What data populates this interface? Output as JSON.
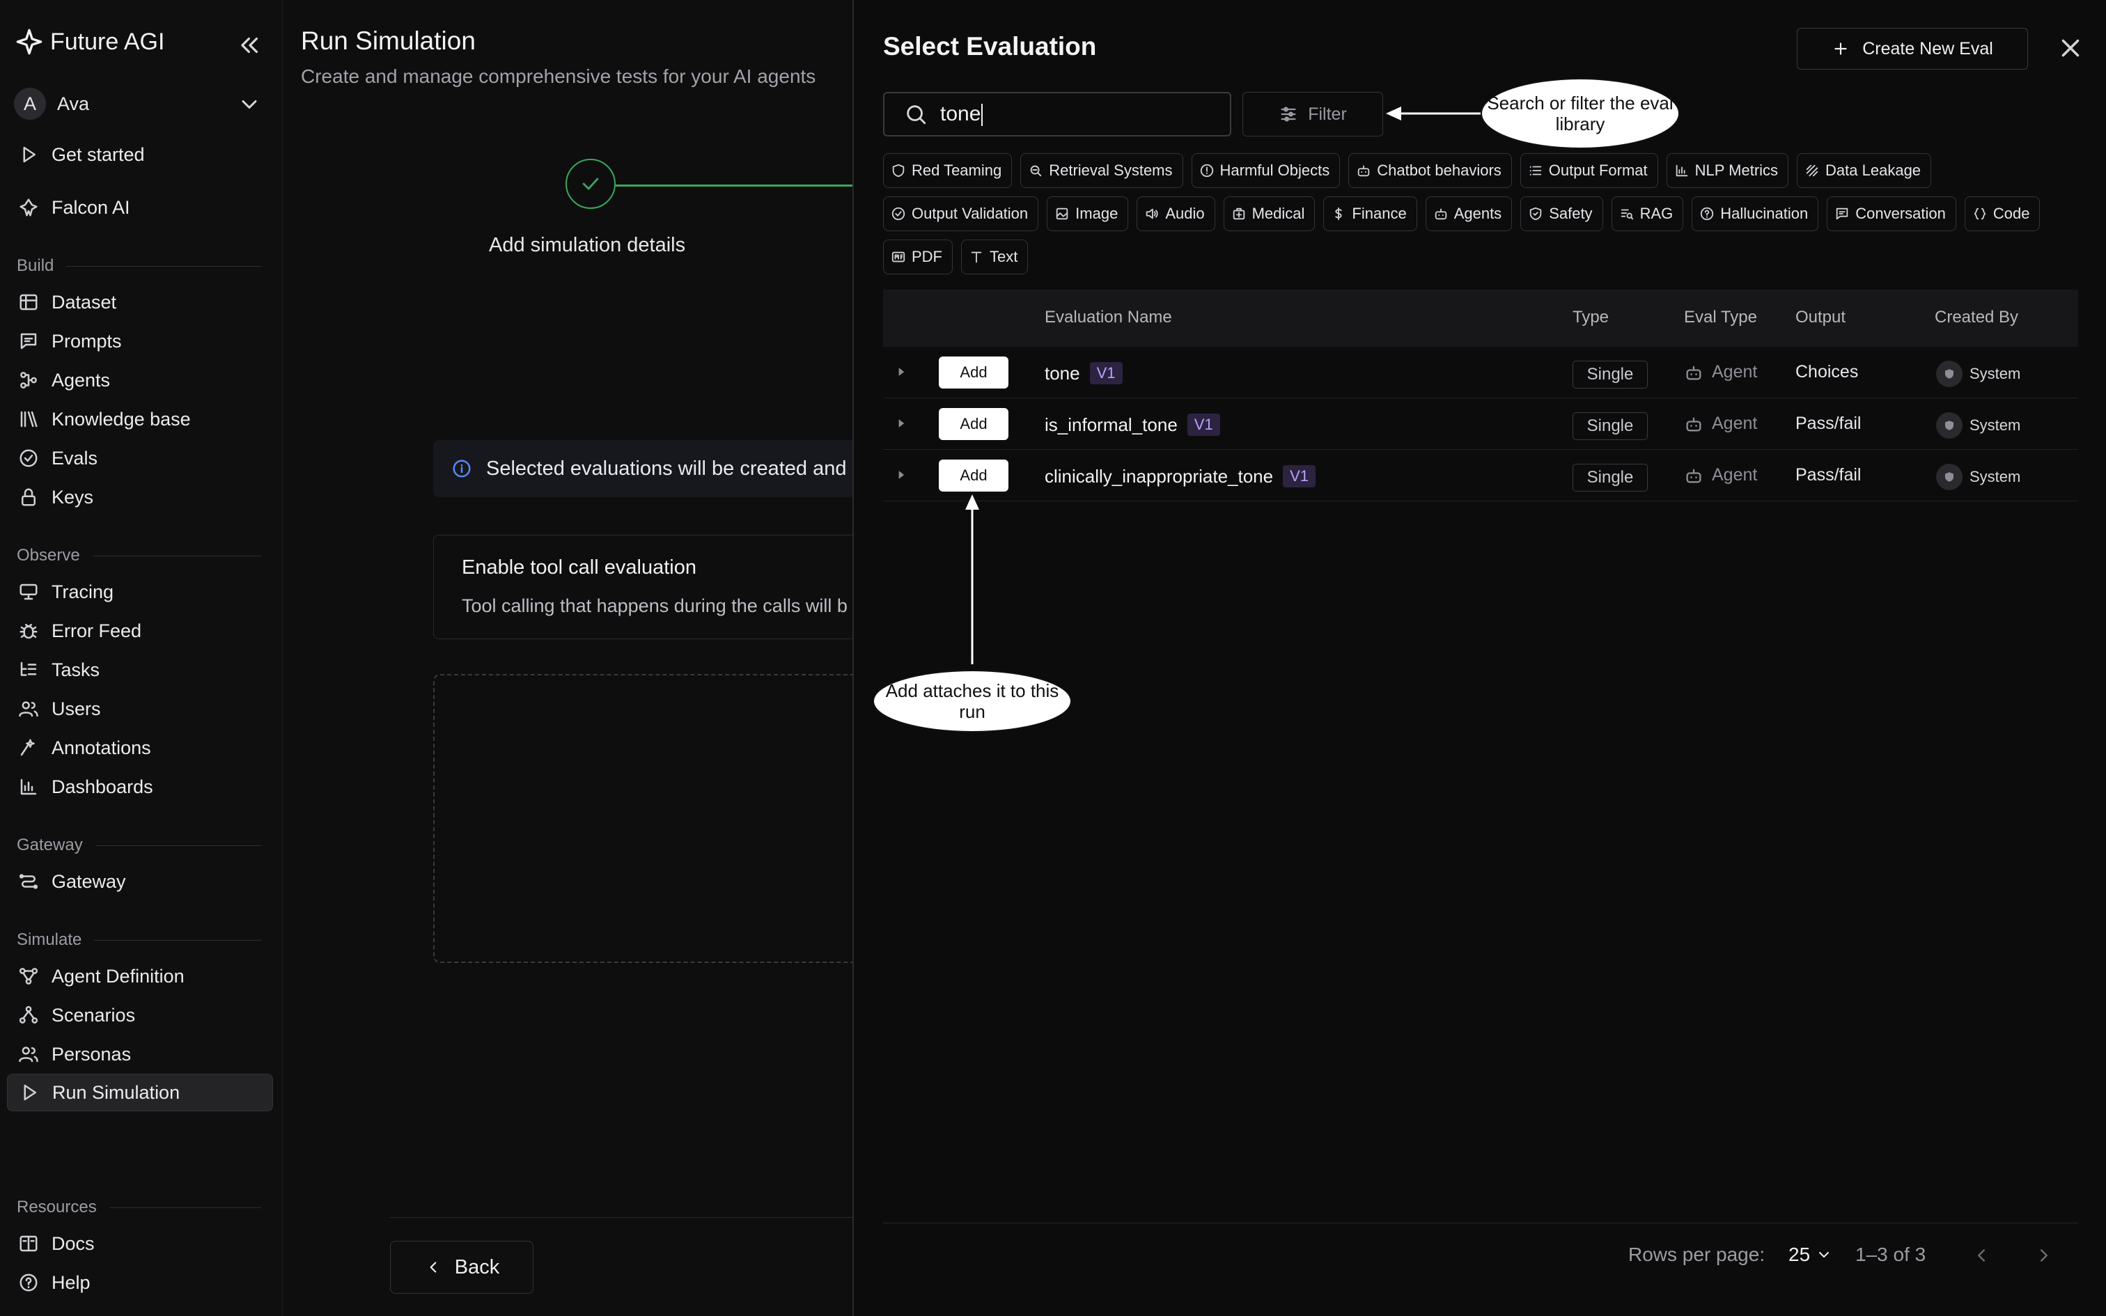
{
  "sidebar": {
    "brand": "Future AGI",
    "user": {
      "initial": "A",
      "name": "Ava"
    },
    "top_items": [
      {
        "label": "Get started",
        "icon": "play-icon"
      },
      {
        "label": "Falcon AI",
        "icon": "falcon-icon"
      }
    ],
    "sections": [
      {
        "title": "Build",
        "items": [
          "Dataset",
          "Prompts",
          "Agents",
          "Knowledge base",
          "Evals",
          "Keys"
        ]
      },
      {
        "title": "Observe",
        "items": [
          "Tracing",
          "Error Feed",
          "Tasks",
          "Users",
          "Annotations",
          "Dashboards"
        ]
      },
      {
        "title": "Gateway",
        "items": [
          "Gateway"
        ]
      },
      {
        "title": "Simulate",
        "items": [
          "Agent Definition",
          "Scenarios",
          "Personas",
          "Run Simulation"
        ]
      },
      {
        "title": "Resources",
        "items": [
          "Docs",
          "Help"
        ]
      }
    ],
    "active_item": "Run Simulation"
  },
  "main": {
    "title": "Run Simulation",
    "subtitle": "Create and manage comprehensive tests for your AI agents",
    "step_label": "Add simulation details",
    "info_text": "Selected evaluations will be created and",
    "toggle_title": "Enable tool call evaluation",
    "toggle_desc": "Tool calling that happens during the calls will b",
    "back_label": "Back"
  },
  "panel": {
    "title": "Select Evaluation",
    "create_label": "Create New Eval",
    "search_value": "tone",
    "filter_label": "Filter",
    "chips_row1": [
      "Red Teaming",
      "Retrieval Systems",
      "Harmful Objects",
      "Chatbot behaviors",
      "Output Format",
      "NLP Metrics",
      "Data Leakage"
    ],
    "chips_row2": [
      "Output Validation",
      "Image",
      "Audio",
      "Medical",
      "Finance",
      "Agents",
      "Safety",
      "RAG",
      "Hallucination",
      "Conversation",
      "Code"
    ],
    "chips_row3": [
      "PDF",
      "Text"
    ],
    "columns": {
      "name": "Evaluation Name",
      "type": "Type",
      "eval_type": "Eval Type",
      "output": "Output",
      "created_by": "Created By"
    },
    "add_label": "Add",
    "rows": [
      {
        "name": "tone",
        "version": "V1",
        "type": "Single",
        "eval_type": "Agent",
        "output": "Choices",
        "created_by": "System"
      },
      {
        "name": "is_informal_tone",
        "version": "V1",
        "type": "Single",
        "eval_type": "Agent",
        "output": "Pass/fail",
        "created_by": "System"
      },
      {
        "name": "clinically_inappropriate_tone",
        "version": "V1",
        "type": "Single",
        "eval_type": "Agent",
        "output": "Pass/fail",
        "created_by": "System"
      }
    ],
    "pagination": {
      "rows_label": "Rows per page:",
      "rows_value": "25",
      "range": "1–3 of 3"
    }
  },
  "annotations": {
    "search_note": "Search or filter the eval library",
    "add_note": "Add attaches it to this run"
  }
}
